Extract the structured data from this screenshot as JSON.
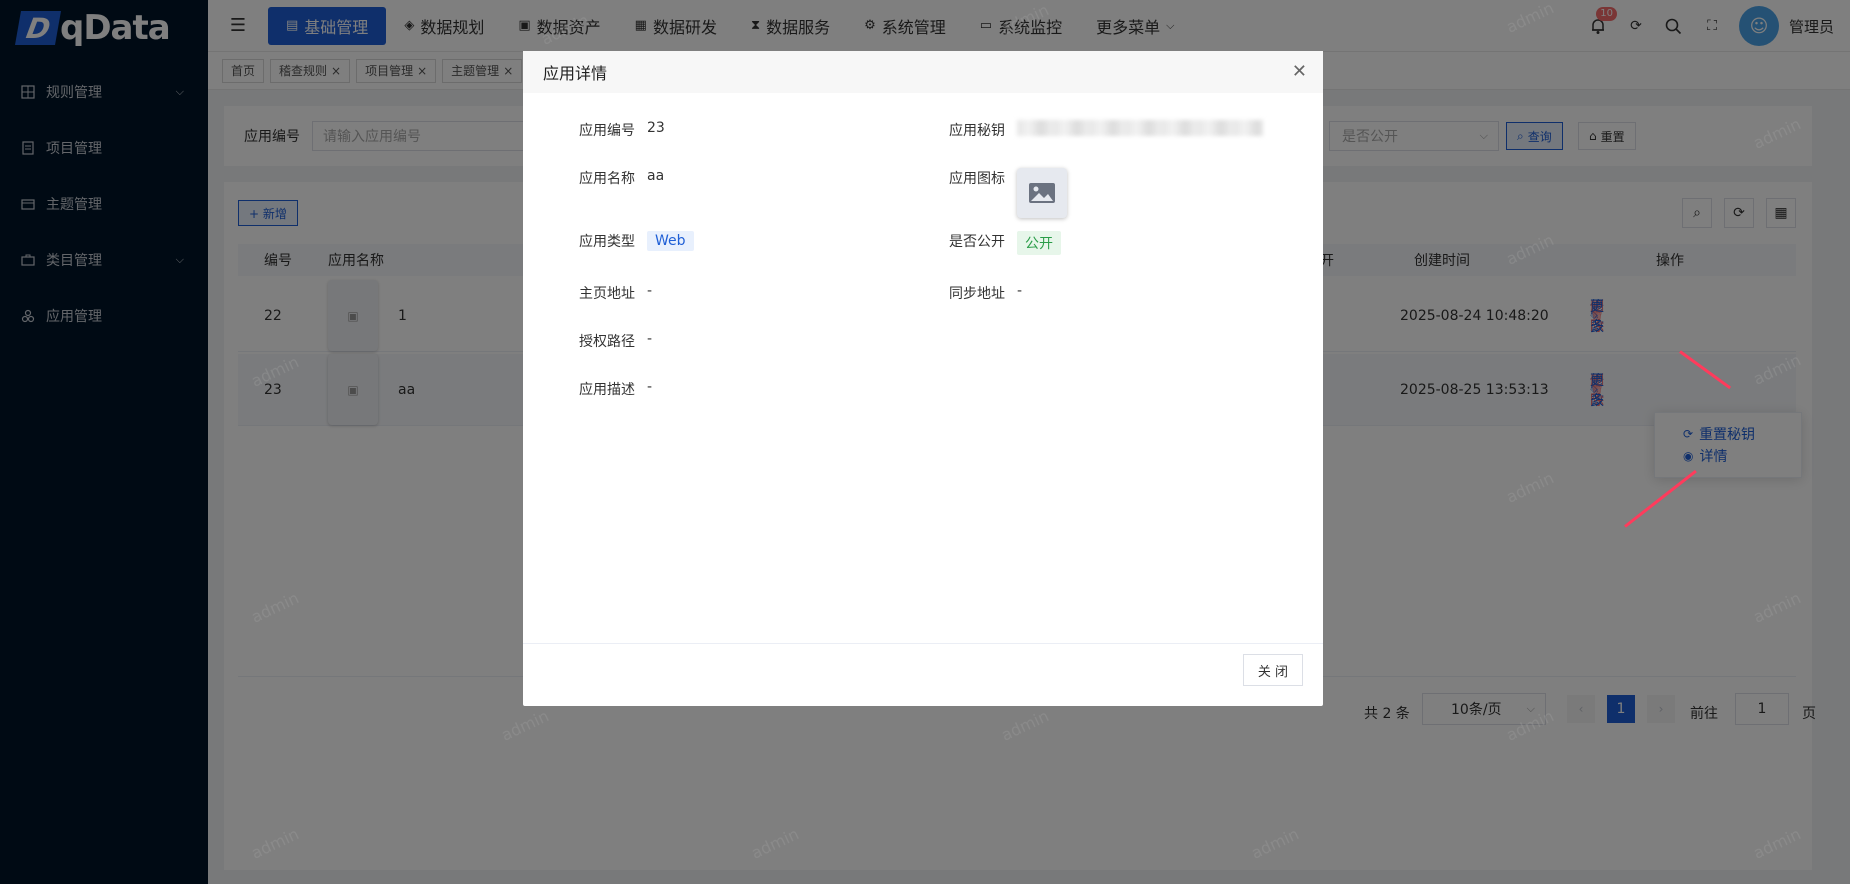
{
  "brand": {
    "logo_mark": "D",
    "logo_text": "qData"
  },
  "sidebar": {
    "items": [
      {
        "label": "规则管理",
        "icon": "grid-icon",
        "has_children": true
      },
      {
        "label": "项目管理",
        "icon": "document-icon",
        "has_children": false
      },
      {
        "label": "主题管理",
        "icon": "folder-icon",
        "has_children": false
      },
      {
        "label": "类目管理",
        "icon": "briefcase-icon",
        "has_children": true
      },
      {
        "label": "应用管理",
        "icon": "apps-icon",
        "has_children": false
      }
    ]
  },
  "header": {
    "nav": [
      {
        "label": "基础管理",
        "active": true
      },
      {
        "label": "数据规划",
        "active": false
      },
      {
        "label": "数据资产",
        "active": false
      },
      {
        "label": "数据研发",
        "active": false
      },
      {
        "label": "数据服务",
        "active": false
      },
      {
        "label": "系统管理",
        "active": false
      },
      {
        "label": "系统监控",
        "active": false
      },
      {
        "label": "更多菜单",
        "active": false
      }
    ],
    "notification_badge": "10",
    "user_name": "管理员"
  },
  "tags": [
    "首页",
    "稽查规则",
    "项目管理",
    "主题管理"
  ],
  "search": {
    "code_label": "应用编号",
    "code_placeholder": "请输入应用编号",
    "public_placeholder": "是否公开",
    "query_label": "查询",
    "reset_label": "重置"
  },
  "table": {
    "add_label": "+ 新增",
    "headers": {
      "id": "编号",
      "name": "应用名称",
      "col_public_tail": "开",
      "created": "创建时间",
      "ops": "操作"
    },
    "rows": [
      {
        "id": "22",
        "name": "1",
        "created": "2025-08-24 10:48:20"
      },
      {
        "id": "23",
        "name": "aa",
        "created": "2025-08-25 13:53:13"
      }
    ],
    "op_edit": "修改",
    "op_delete": "删除",
    "op_more": "更多",
    "thumb_glyph": "▣"
  },
  "dropdown": {
    "reset_secret": "重置秘钥",
    "details": "详情"
  },
  "pagination": {
    "total": "共 2 条",
    "page_size": "10条/页",
    "current": "1",
    "goto_label": "前往",
    "goto_value": "1",
    "page_suffix": "页",
    "prev": "‹",
    "next": "›"
  },
  "watermark": "admin",
  "modal": {
    "title": "应用详情",
    "close_glyph": "✕",
    "fields": {
      "code_label": "应用编号",
      "code_value": "23",
      "secret_label": "应用秘钥",
      "name_label": "应用名称",
      "name_value": "aa",
      "icon_label": "应用图标",
      "type_label": "应用类型",
      "type_value": "Web",
      "public_label": "是否公开",
      "public_value": "公开",
      "home_label": "主页地址",
      "home_value": "-",
      "sync_label": "同步地址",
      "sync_value": "-",
      "auth_label": "授权路径",
      "auth_value": "-",
      "desc_label": "应用描述",
      "desc_value": "-"
    },
    "close_button": "关 闭"
  },
  "colors": {
    "primary": "#1f5fd6",
    "danger": "#f56c6c",
    "success": "#2a9d48",
    "sidebar_bg": "#001529",
    "arrow": "#ff3b5c"
  }
}
